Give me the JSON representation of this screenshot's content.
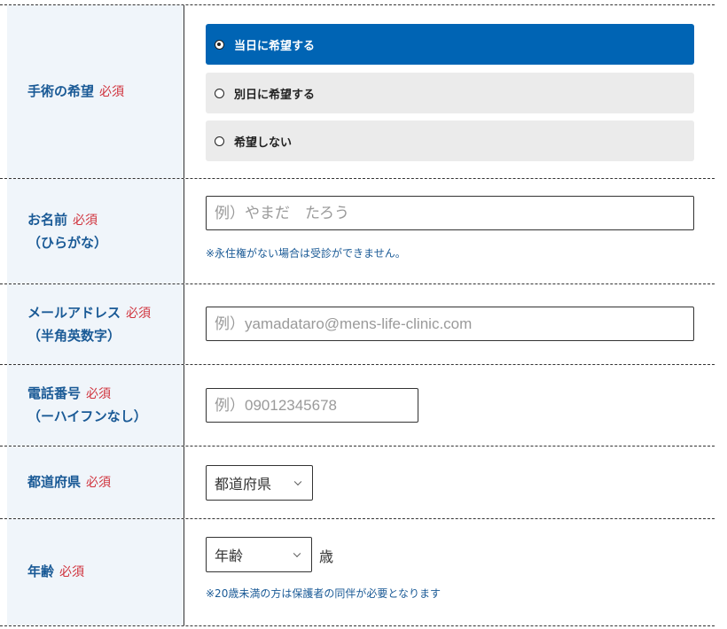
{
  "required_label": "必須",
  "surgery": {
    "label": "手術の希望",
    "options": [
      "当日に希望する",
      "別日に希望する",
      "希望しない"
    ],
    "selected_index": 0
  },
  "name": {
    "label": "お名前",
    "sublabel": "（ひらがな）",
    "placeholder": "例）やまだ　たろう",
    "note": "※永住権がない場合は受診ができません。"
  },
  "email": {
    "label": "メールアドレス",
    "sublabel": "（半角英数字）",
    "placeholder": "例）yamadataro@mens-life-clinic.com"
  },
  "phone": {
    "label": "電話番号",
    "sublabel": "（ーハイフンなし）",
    "placeholder": "例）09012345678"
  },
  "prefecture": {
    "label": "都道府県",
    "value": "都道府県"
  },
  "age": {
    "label": "年齢",
    "value": "年齢",
    "suffix": "歳",
    "note": "※20歳未満の方は保護者の同伴が必要となります"
  },
  "colors": {
    "accent": "#0064b4",
    "label_text": "#1a5a96",
    "required": "#d0323c",
    "label_bg": "#f0f5fa",
    "option_bg": "#ebebeb"
  }
}
